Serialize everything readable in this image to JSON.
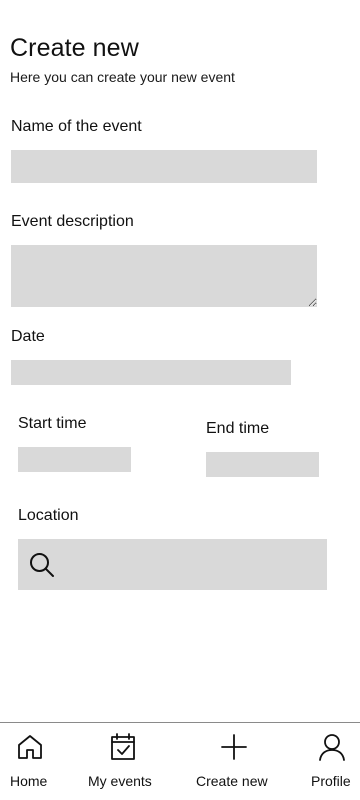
{
  "header": {
    "title": "Create new",
    "subtitle": "Here you can create your new event"
  },
  "form": {
    "name_label": "Name of the event",
    "name_value": "",
    "description_label": "Event description",
    "description_value": "",
    "date_label": "Date",
    "date_value": "",
    "start_time_label": "Start time",
    "start_time_value": "",
    "end_time_label": "End time",
    "end_time_value": "",
    "location_label": "Location",
    "location_value": "",
    "location_icon": "search-icon"
  },
  "colors": {
    "field_background": "#d9d9d9",
    "text": "#111111",
    "nav_divider": "#8a8a8a"
  },
  "bottom_nav": {
    "items": [
      {
        "label": "Home",
        "icon": "home-icon"
      },
      {
        "label": "My events",
        "icon": "calendar-check-icon"
      },
      {
        "label": "Create new",
        "icon": "plus-icon"
      },
      {
        "label": "Profile",
        "icon": "user-icon"
      }
    ]
  }
}
